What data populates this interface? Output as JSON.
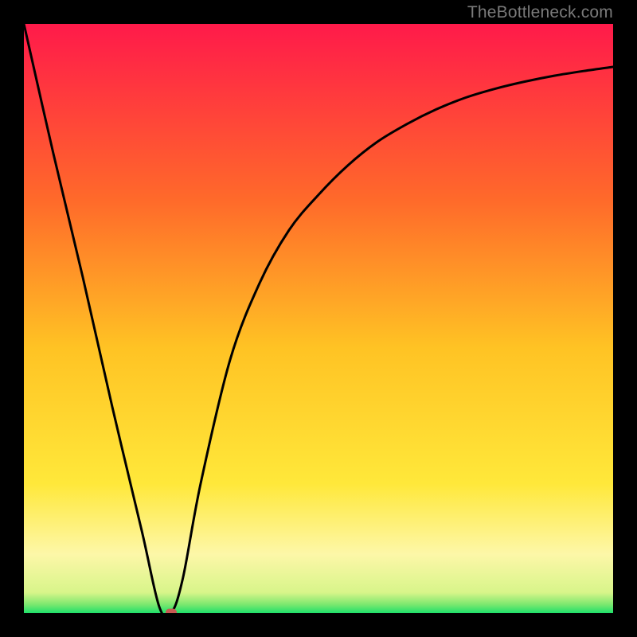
{
  "attribution": "TheBottleneck.com",
  "colors": {
    "top": "#ff1a4a",
    "mid_upper": "#ff7a2a",
    "mid": "#ffc324",
    "mid_lower": "#ffe83a",
    "pale": "#fdf7a8",
    "green": "#1fe06a",
    "border": "#000000",
    "curve": "#000000",
    "marker": "#c85a52"
  },
  "chart_data": {
    "type": "line",
    "title": "",
    "xlabel": "",
    "ylabel": "",
    "xlim": [
      0,
      100
    ],
    "ylim": [
      0,
      100
    ],
    "series": [
      {
        "name": "curve",
        "x": [
          0,
          5,
          10,
          15,
          20,
          23,
          25,
          27,
          30,
          35,
          40,
          45,
          50,
          55,
          60,
          65,
          70,
          75,
          80,
          85,
          90,
          95,
          100
        ],
        "values": [
          100,
          78,
          57,
          35,
          14,
          1,
          0,
          6,
          22,
          43,
          56,
          65,
          71,
          76,
          80,
          83,
          85.5,
          87.5,
          89,
          90.2,
          91.2,
          92,
          92.7
        ]
      }
    ],
    "marker": {
      "x": 25,
      "y": 0
    },
    "gradient_stops": [
      {
        "pos": 0,
        "color": "#ff1a4a"
      },
      {
        "pos": 0.3,
        "color": "#ff6a2a"
      },
      {
        "pos": 0.55,
        "color": "#ffc324"
      },
      {
        "pos": 0.78,
        "color": "#ffe83a"
      },
      {
        "pos": 0.9,
        "color": "#fdf7a8"
      },
      {
        "pos": 0.965,
        "color": "#d8f58a"
      },
      {
        "pos": 0.985,
        "color": "#7ee86f"
      },
      {
        "pos": 1.0,
        "color": "#1fe06a"
      }
    ]
  }
}
